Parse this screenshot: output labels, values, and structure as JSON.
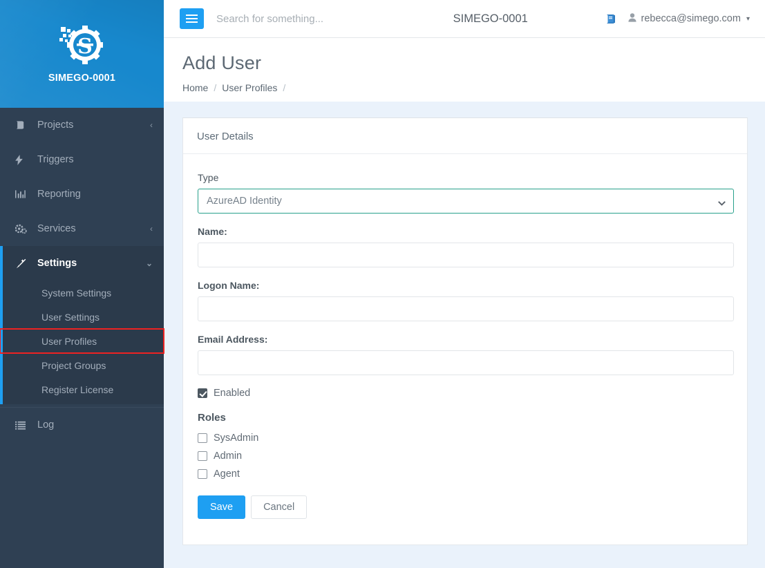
{
  "brand": {
    "name": "SIMEGO-0001",
    "logo_icon": "gear-s-logo",
    "bg_color": "#1788cd"
  },
  "sidebar": {
    "items": [
      {
        "label": "Projects",
        "icon": "book-icon",
        "caret": "‹"
      },
      {
        "label": "Triggers",
        "icon": "bolt-icon",
        "caret": ""
      },
      {
        "label": "Reporting",
        "icon": "bar-chart-icon",
        "caret": ""
      },
      {
        "label": "Services",
        "icon": "gears-icon",
        "caret": "‹"
      },
      {
        "label": "Settings",
        "icon": "magic-wand-icon",
        "caret": "⌄",
        "active": true
      }
    ],
    "submenu": [
      {
        "label": "System Settings"
      },
      {
        "label": "User Settings"
      },
      {
        "label": "User Profiles",
        "highlighted": true
      },
      {
        "label": "Project Groups"
      },
      {
        "label": "Register License"
      }
    ],
    "log": {
      "label": "Log",
      "icon": "list-icon"
    }
  },
  "topbar": {
    "menu_toggle_icon": "hamburger-icon",
    "search_placeholder": "Search for something...",
    "search_value": "",
    "title": "SIMEGO-0001",
    "docs_icon": "book-icon",
    "user_icon": "user-icon",
    "user_email": "rebecca@simego.com",
    "user_caret": "▾"
  },
  "page": {
    "title": "Add User",
    "breadcrumb": [
      {
        "label": "Home",
        "sep": "/"
      },
      {
        "label": "User Profiles",
        "sep": "/"
      }
    ]
  },
  "card": {
    "header": "User Details",
    "type_field": {
      "label": "Type",
      "value": "AzureAD Identity",
      "options": [
        "AzureAD Identity"
      ],
      "border_color": "#27a08b",
      "caret_icon": "chevron-down-icon"
    },
    "fields": [
      {
        "label": "Name:",
        "value": "",
        "name": "name-field"
      },
      {
        "label": "Logon Name:",
        "value": "",
        "name": "logon-name-field"
      },
      {
        "label": "Email Address:",
        "value": "",
        "name": "email-field"
      }
    ],
    "enabled": {
      "label": "Enabled",
      "checked": true
    },
    "roles_title": "Roles",
    "roles": [
      {
        "label": "SysAdmin",
        "checked": false
      },
      {
        "label": "Admin",
        "checked": false
      },
      {
        "label": "Agent",
        "checked": false
      }
    ],
    "buttons": {
      "save": "Save",
      "cancel": "Cancel"
    }
  },
  "colors": {
    "accent_blue": "#1e9ff2",
    "sidebar_bg": "#2f4053",
    "brand_blue": "#1788cd",
    "page_bg": "#eaf2fb",
    "select_border": "#27a08b",
    "highlight_red": "#ee2222"
  }
}
